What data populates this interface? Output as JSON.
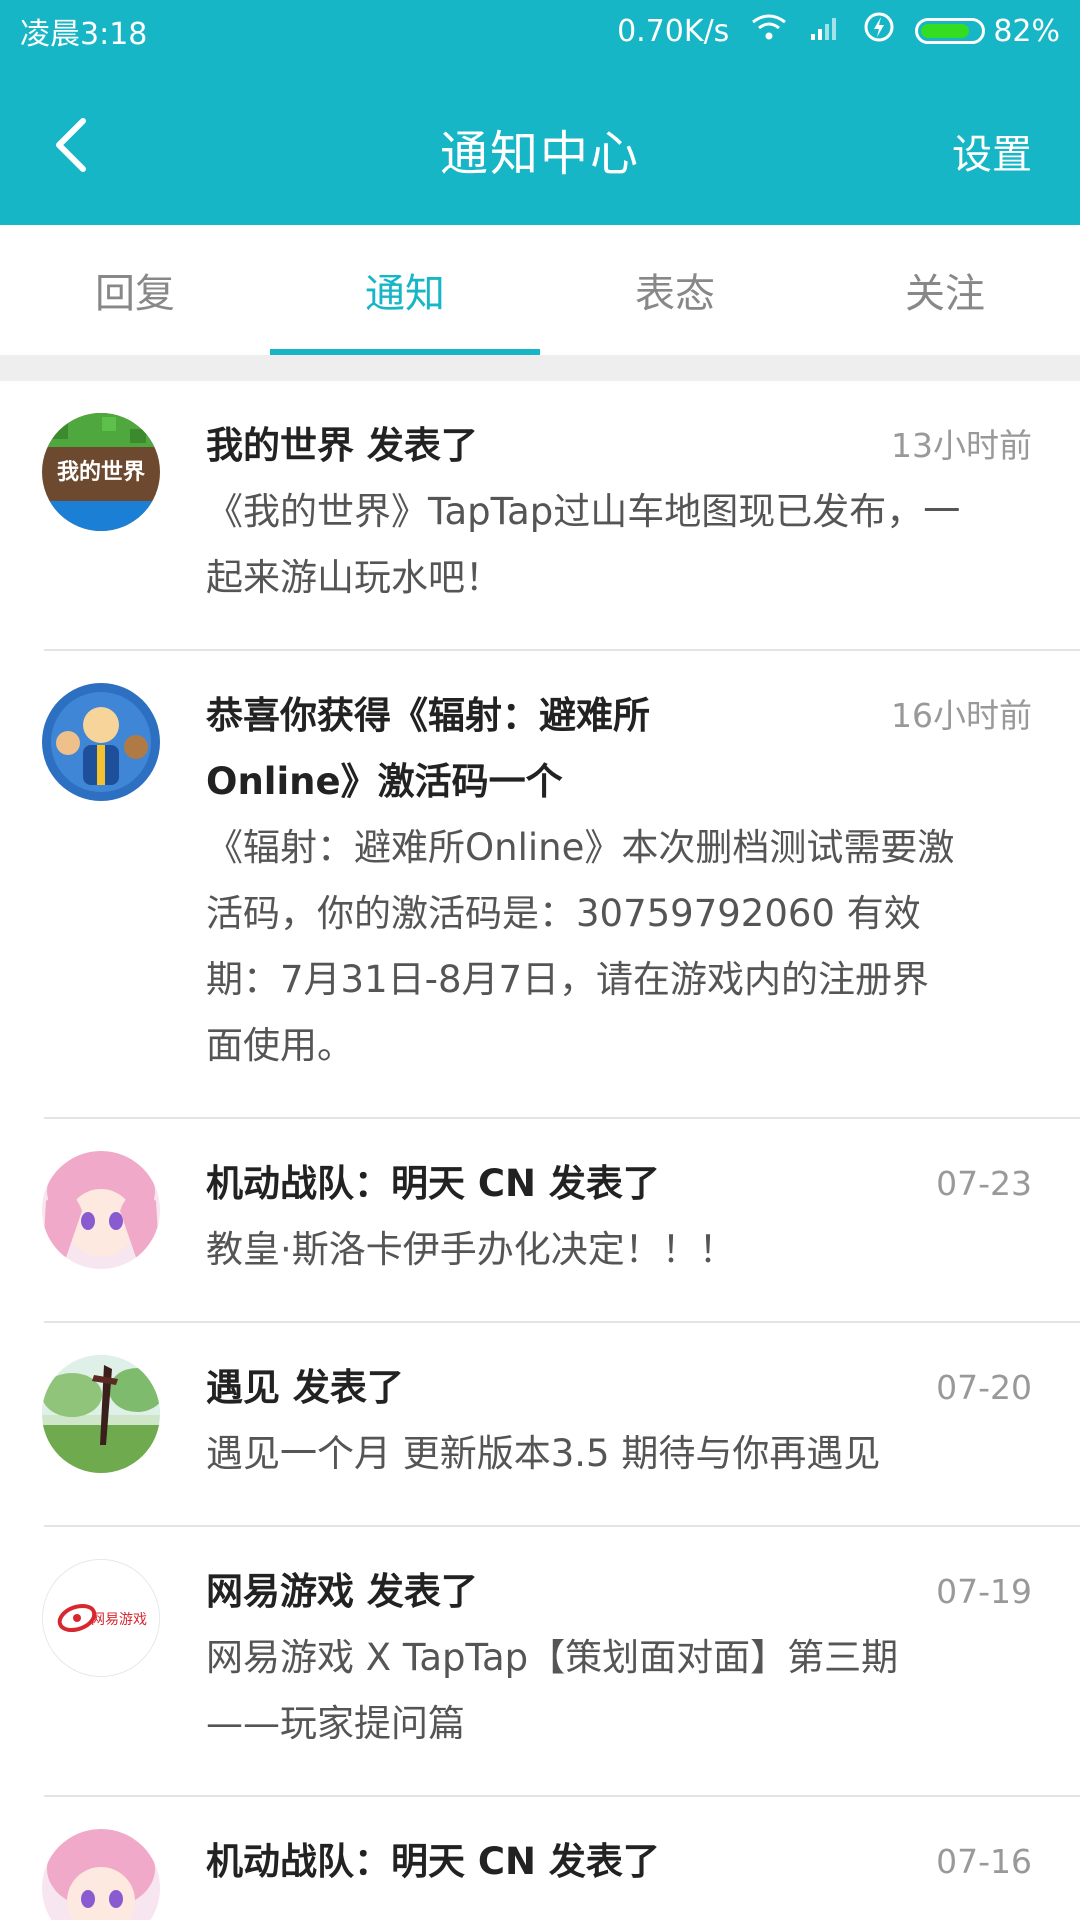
{
  "status": {
    "time": "凌晨3:18",
    "network_speed": "0.70K/s",
    "battery": "82%",
    "battery_level": 0.82,
    "icons": [
      "wifi-icon",
      "signal-icon",
      "charging-icon",
      "battery-icon"
    ]
  },
  "header": {
    "title": "通知中心",
    "settings_label": "设置",
    "back_icon": "chevron-left-icon"
  },
  "tabs": [
    {
      "label": "回复"
    },
    {
      "label": "通知"
    },
    {
      "label": "表态"
    },
    {
      "label": "关注"
    }
  ],
  "active_tab": "通知",
  "notifications": [
    {
      "title": "我的世界 发表了",
      "time": "13小时前",
      "body": "《我的世界》TapTap过山车地图现已发布，一起来游山玩水吧！",
      "avatar_icon": "minecraft-icon",
      "avatar_text": "我的世界"
    },
    {
      "title": "恭喜你获得《辐射：避难所Online》激活码一个",
      "time": "16小时前",
      "body": "《辐射：避难所Online》本次删档测试需要激活码，你的激活码是：30759792060 有效期：7月31日-8月7日，请在游戏内的注册界面使用。",
      "avatar_icon": "fallout-shelter-icon"
    },
    {
      "title": "机动战队：明天 CN 发表了",
      "time": "07-23",
      "body": "教皇·斯洛卡伊手办化决定！！！",
      "avatar_icon": "anime-girl-icon"
    },
    {
      "title": "遇见 发表了",
      "time": "07-20",
      "body": "遇见一个月 更新版本3.5 期待与你再遇见",
      "avatar_icon": "sword-landscape-icon"
    },
    {
      "title": "网易游戏 发表了",
      "time": "07-19",
      "body": "网易游戏 X TapTap【策划面对面】第三期——玩家提问篇",
      "avatar_icon": "netease-games-icon",
      "avatar_text": "网易游戏"
    },
    {
      "title": "机动战队：明天 CN 发表了",
      "time": "07-16",
      "body": "",
      "avatar_icon": "anime-girl-icon"
    }
  ],
  "colors": {
    "accent": "#17b6c6",
    "title_text": "#222222",
    "body_text": "#555555",
    "muted_text": "#999999"
  }
}
